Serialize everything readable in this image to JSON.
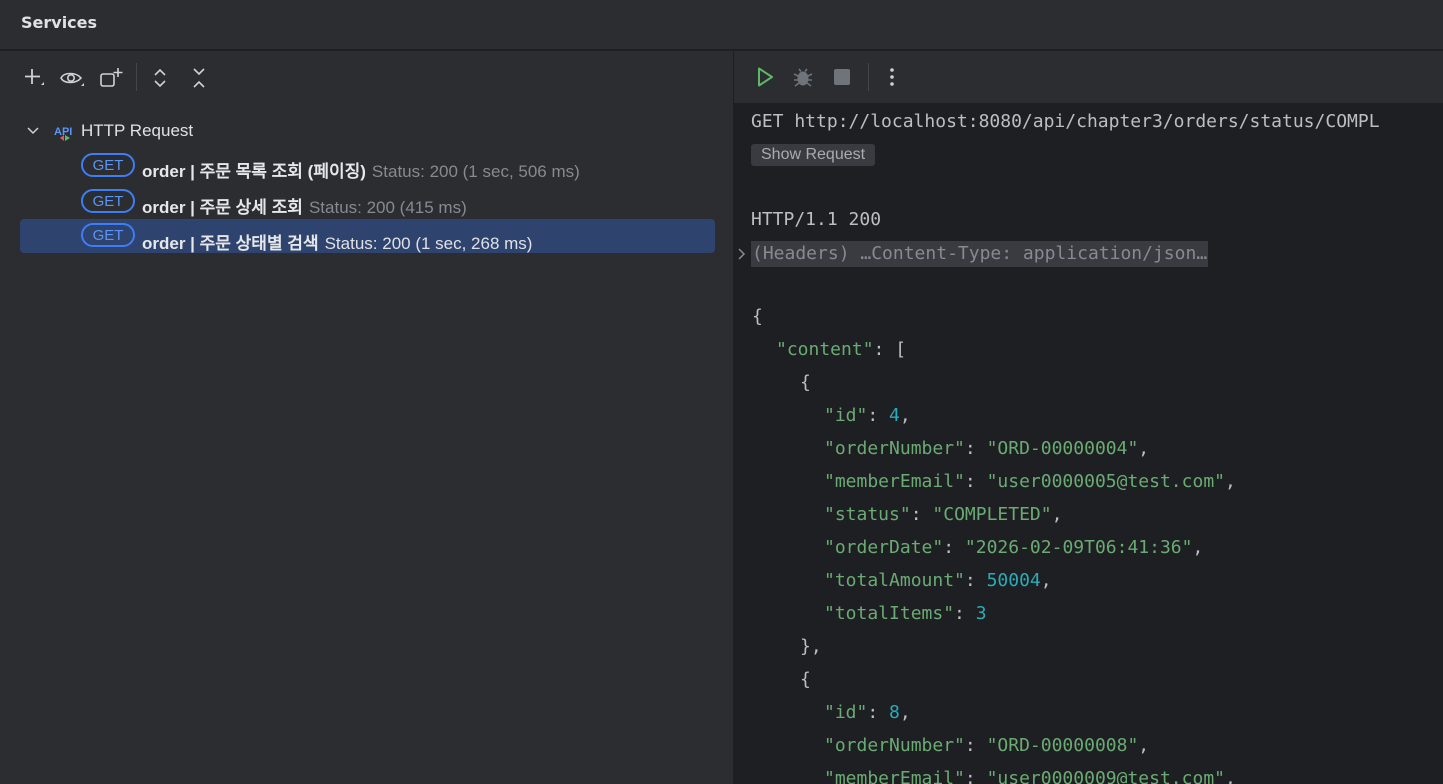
{
  "window": {
    "title": "Services"
  },
  "left_toolbar": {
    "icons": [
      "add-icon",
      "eye-icon",
      "new-group-icon",
      "expand-all-icon",
      "collapse-all-icon"
    ]
  },
  "tree": {
    "root": {
      "label": "HTTP Request",
      "icon": "api-icon",
      "expanded": true
    },
    "requests": [
      {
        "method": "GET",
        "name": "order  |  주문 목록 조회 (페이징)",
        "status": "Status: 200 (1 sec, 506 ms)",
        "selected": false
      },
      {
        "method": "GET",
        "name": "order  |  주문 상세 조회",
        "status": "Status: 200 (415 ms)",
        "selected": false
      },
      {
        "method": "GET",
        "name": "order  |  주문 상태별 검색",
        "status": "Status: 200 (1 sec, 268 ms)",
        "selected": true
      }
    ]
  },
  "right_toolbar": {
    "icons": [
      "run-icon",
      "debug-icon",
      "stop-icon",
      "more-icon"
    ]
  },
  "response": {
    "request_line": "GET http://localhost:8080/api/chapter3/orders/status/COMPL",
    "show_request_label": "Show Request",
    "status_line": "HTTP/1.1 200",
    "headers_summary": "(Headers) …Content-Type: application/json…",
    "body_lines": [
      {
        "indent": 0,
        "parts": [
          [
            "punc",
            "{"
          ]
        ]
      },
      {
        "indent": 1,
        "parts": [
          [
            "key",
            "\"content\""
          ],
          [
            "punc",
            ": ["
          ]
        ]
      },
      {
        "indent": 2,
        "parts": [
          [
            "punc",
            "{"
          ]
        ]
      },
      {
        "indent": 3,
        "parts": [
          [
            "key",
            "\"id\""
          ],
          [
            "punc",
            ": "
          ],
          [
            "num",
            "4"
          ],
          [
            "punc",
            ","
          ]
        ]
      },
      {
        "indent": 3,
        "parts": [
          [
            "key",
            "\"orderNumber\""
          ],
          [
            "punc",
            ": "
          ],
          [
            "str",
            "\"ORD-00000004\""
          ],
          [
            "punc",
            ","
          ]
        ]
      },
      {
        "indent": 3,
        "parts": [
          [
            "key",
            "\"memberEmail\""
          ],
          [
            "punc",
            ": "
          ],
          [
            "str",
            "\"user0000005@test.com\""
          ],
          [
            "punc",
            ","
          ]
        ]
      },
      {
        "indent": 3,
        "parts": [
          [
            "key",
            "\"status\""
          ],
          [
            "punc",
            ": "
          ],
          [
            "str",
            "\"COMPLETED\""
          ],
          [
            "punc",
            ","
          ]
        ]
      },
      {
        "indent": 3,
        "parts": [
          [
            "key",
            "\"orderDate\""
          ],
          [
            "punc",
            ": "
          ],
          [
            "str",
            "\"2026-02-09T06:41:36\""
          ],
          [
            "punc",
            ","
          ]
        ]
      },
      {
        "indent": 3,
        "parts": [
          [
            "key",
            "\"totalAmount\""
          ],
          [
            "punc",
            ": "
          ],
          [
            "num",
            "50004"
          ],
          [
            "punc",
            ","
          ]
        ]
      },
      {
        "indent": 3,
        "parts": [
          [
            "key",
            "\"totalItems\""
          ],
          [
            "punc",
            ": "
          ],
          [
            "num",
            "3"
          ]
        ]
      },
      {
        "indent": 2,
        "parts": [
          [
            "punc",
            "},"
          ]
        ]
      },
      {
        "indent": 2,
        "parts": [
          [
            "punc",
            "{"
          ]
        ]
      },
      {
        "indent": 3,
        "parts": [
          [
            "key",
            "\"id\""
          ],
          [
            "punc",
            ": "
          ],
          [
            "num",
            "8"
          ],
          [
            "punc",
            ","
          ]
        ]
      },
      {
        "indent": 3,
        "parts": [
          [
            "key",
            "\"orderNumber\""
          ],
          [
            "punc",
            ": "
          ],
          [
            "str",
            "\"ORD-00000008\""
          ],
          [
            "punc",
            ","
          ]
        ]
      },
      {
        "indent": 3,
        "parts": [
          [
            "key",
            "\"memberEmail\""
          ],
          [
            "punc",
            ": "
          ],
          [
            "str",
            "\"user0000009@test.com\""
          ],
          [
            "punc",
            ","
          ]
        ]
      }
    ]
  },
  "colors": {
    "method_badge": "#3d7ef5",
    "selected_row": "#2e436e",
    "json_key": "#6aab73",
    "json_number": "#2aacb8",
    "run_green": "#5fb865"
  }
}
